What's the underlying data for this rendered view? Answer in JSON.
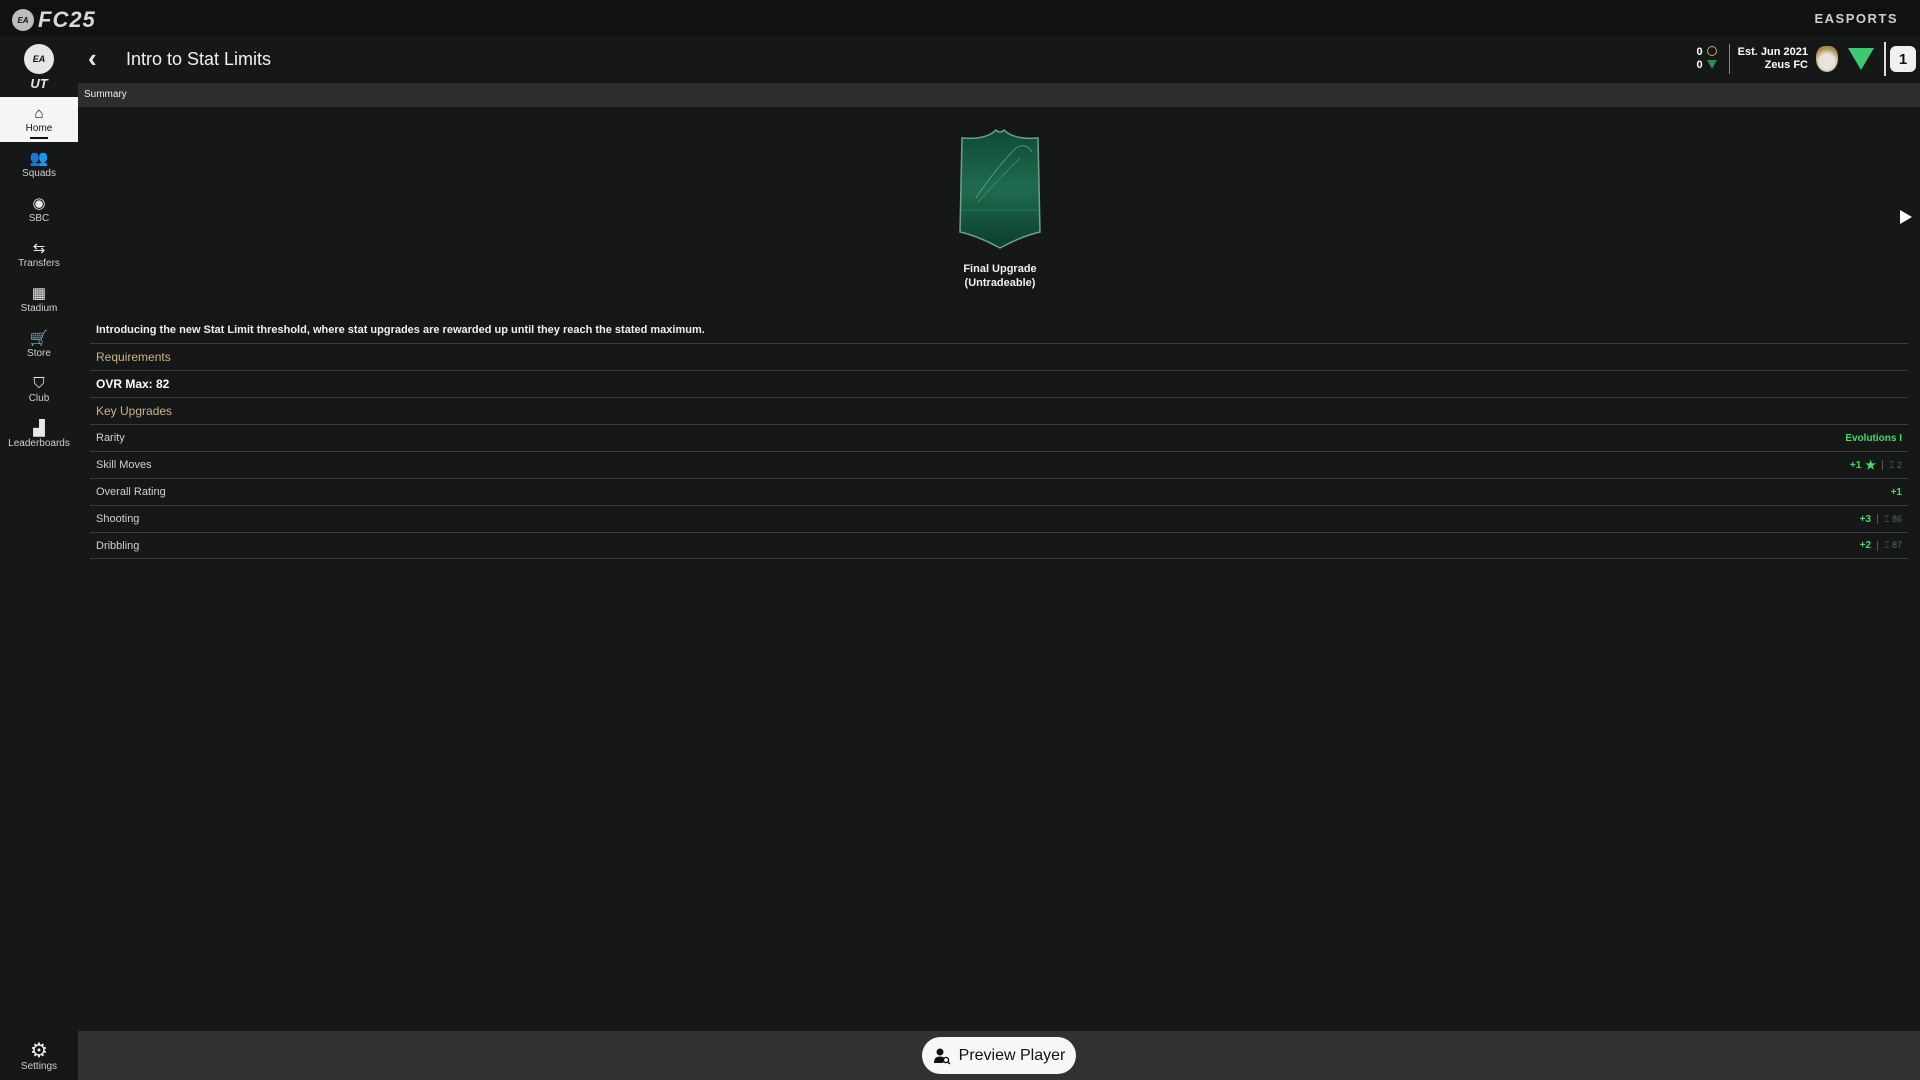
{
  "app": {
    "brand": "FC25",
    "ea_badge": "EA",
    "publisher": "EASPORTS",
    "mode_logo": "UT"
  },
  "sidebar": {
    "items": [
      {
        "label": "Home",
        "icon": "home-icon",
        "glyph": "⌂",
        "active": true
      },
      {
        "label": "Squads",
        "icon": "squads-icon",
        "glyph": "👥",
        "active": false
      },
      {
        "label": "SBC",
        "icon": "sbc-icon",
        "glyph": "◉",
        "active": false
      },
      {
        "label": "Transfers",
        "icon": "transfers-icon",
        "glyph": "⇆",
        "active": false
      },
      {
        "label": "Stadium",
        "icon": "stadium-icon",
        "glyph": "▦",
        "active": false
      },
      {
        "label": "Store",
        "icon": "cart-icon",
        "glyph": "🛒",
        "active": false
      },
      {
        "label": "Club",
        "icon": "club-icon",
        "glyph": "⛉",
        "active": false
      },
      {
        "label": "Leaderboards",
        "icon": "leaderboards-icon",
        "glyph": "▟",
        "active": false
      }
    ],
    "settings": {
      "label": "Settings",
      "glyph": "⚙"
    }
  },
  "header": {
    "back_glyph": "‹",
    "title": "Intro to Stat Limits",
    "coins": "0",
    "points": "0",
    "club_est": "Est. Jun 2021",
    "club_name": "Zeus FC",
    "swap_glyph": "1"
  },
  "tabs": {
    "active": "Summary"
  },
  "reward": {
    "label_line1": "Final Upgrade",
    "label_line2": "(Untradeable)",
    "card_color": "#1f6b4f"
  },
  "description": "Introducing the new Stat Limit threshold, where stat upgrades are rewarded up until they reach the stated maximum.",
  "requirements": {
    "heading": "Requirements",
    "items": [
      "OVR Max: 82"
    ]
  },
  "key_upgrades": {
    "heading": "Key Upgrades",
    "rows": [
      {
        "label": "Rarity",
        "value": "Evolutions I",
        "star": false,
        "limit": null
      },
      {
        "label": "Skill Moves",
        "value": "+1",
        "star": true,
        "limit": "2"
      },
      {
        "label": "Overall Rating",
        "value": "+1",
        "star": false,
        "limit": null
      },
      {
        "label": "Shooting",
        "value": "+3",
        "star": false,
        "limit": "86"
      },
      {
        "label": "Dribbling",
        "value": "+2",
        "star": false,
        "limit": "87"
      }
    ],
    "limit_glyph": "⌶"
  },
  "bottom": {
    "preview_button": "Preview Player"
  },
  "colors": {
    "accent_green": "#3fdc6a",
    "section_heading": "#c9b48a",
    "background": "#161717"
  }
}
